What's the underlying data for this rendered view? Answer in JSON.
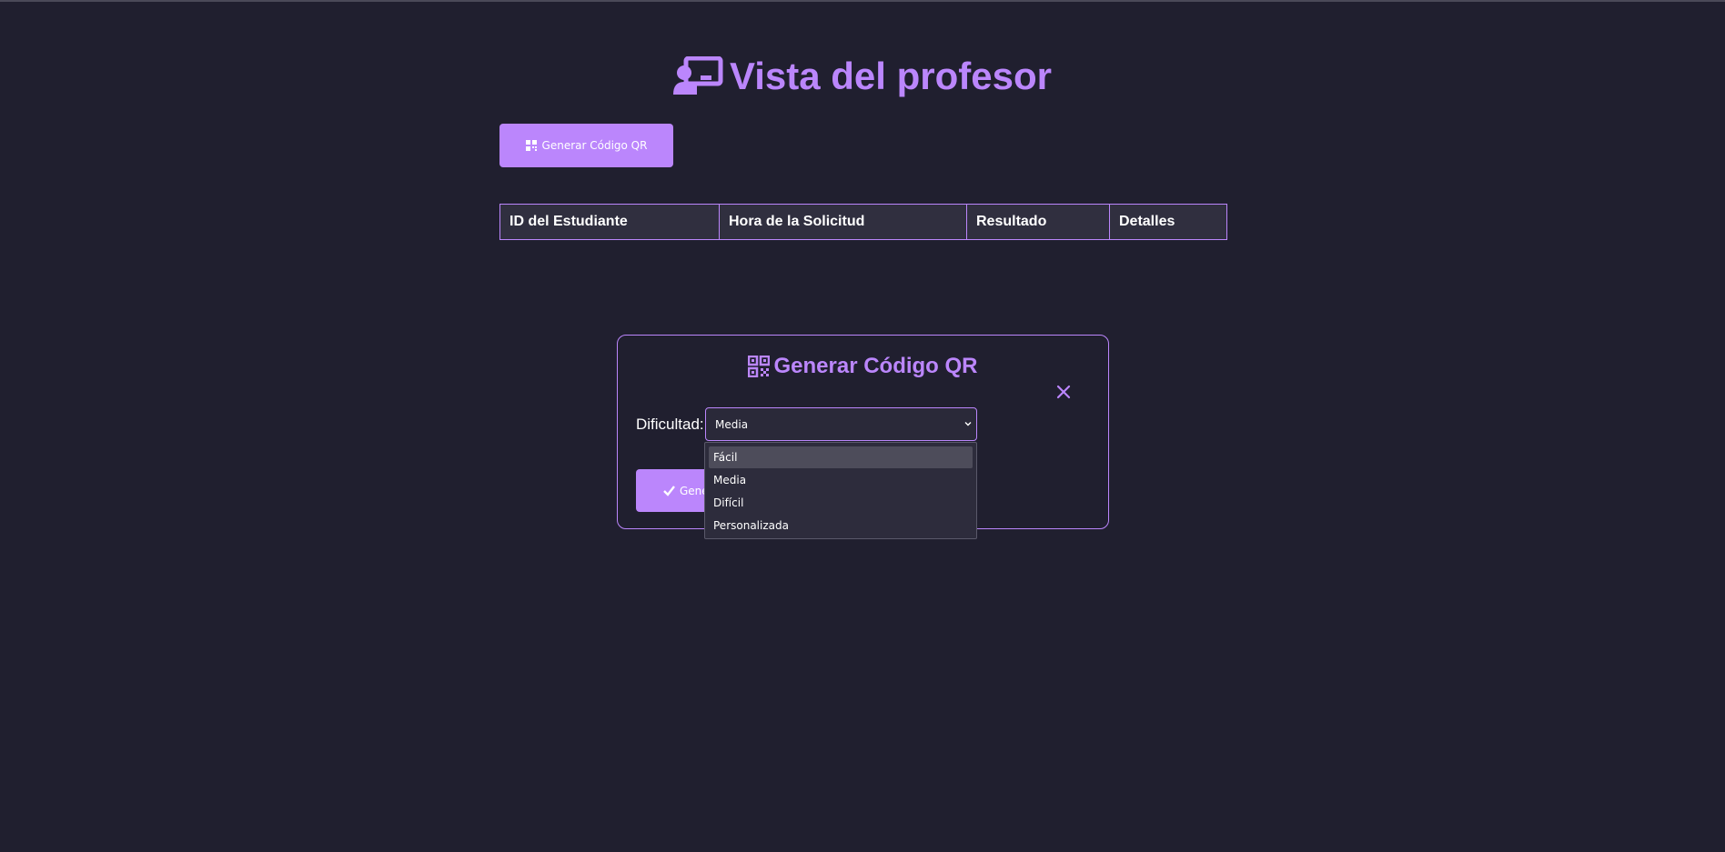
{
  "header": {
    "title": "Vista del profesor",
    "icon": "chalkboard-teacher-icon"
  },
  "toolbar": {
    "generate_qr_label": "Generar Código QR",
    "generate_qr_icon": "qrcode-icon"
  },
  "table": {
    "columns": [
      "ID del Estudiante",
      "Hora de la Solicitud",
      "Resultado",
      "Detalles"
    ],
    "rows": []
  },
  "modal": {
    "title": "Generar Código QR",
    "title_icon": "qrcode-icon",
    "close_icon": "close-icon",
    "difficulty_label": "Dificultad:",
    "difficulty_selected": "Media",
    "confirm_label_partial": "Gene",
    "confirm_icon": "check-icon"
  },
  "dropdown": {
    "options": [
      "Fácil",
      "Media",
      "Difícil",
      "Personalizada"
    ],
    "highlighted": "Fácil"
  },
  "colors": {
    "accent": "#bb86fc",
    "background": "#201f2f",
    "table_header_bg": "#302f3f"
  }
}
